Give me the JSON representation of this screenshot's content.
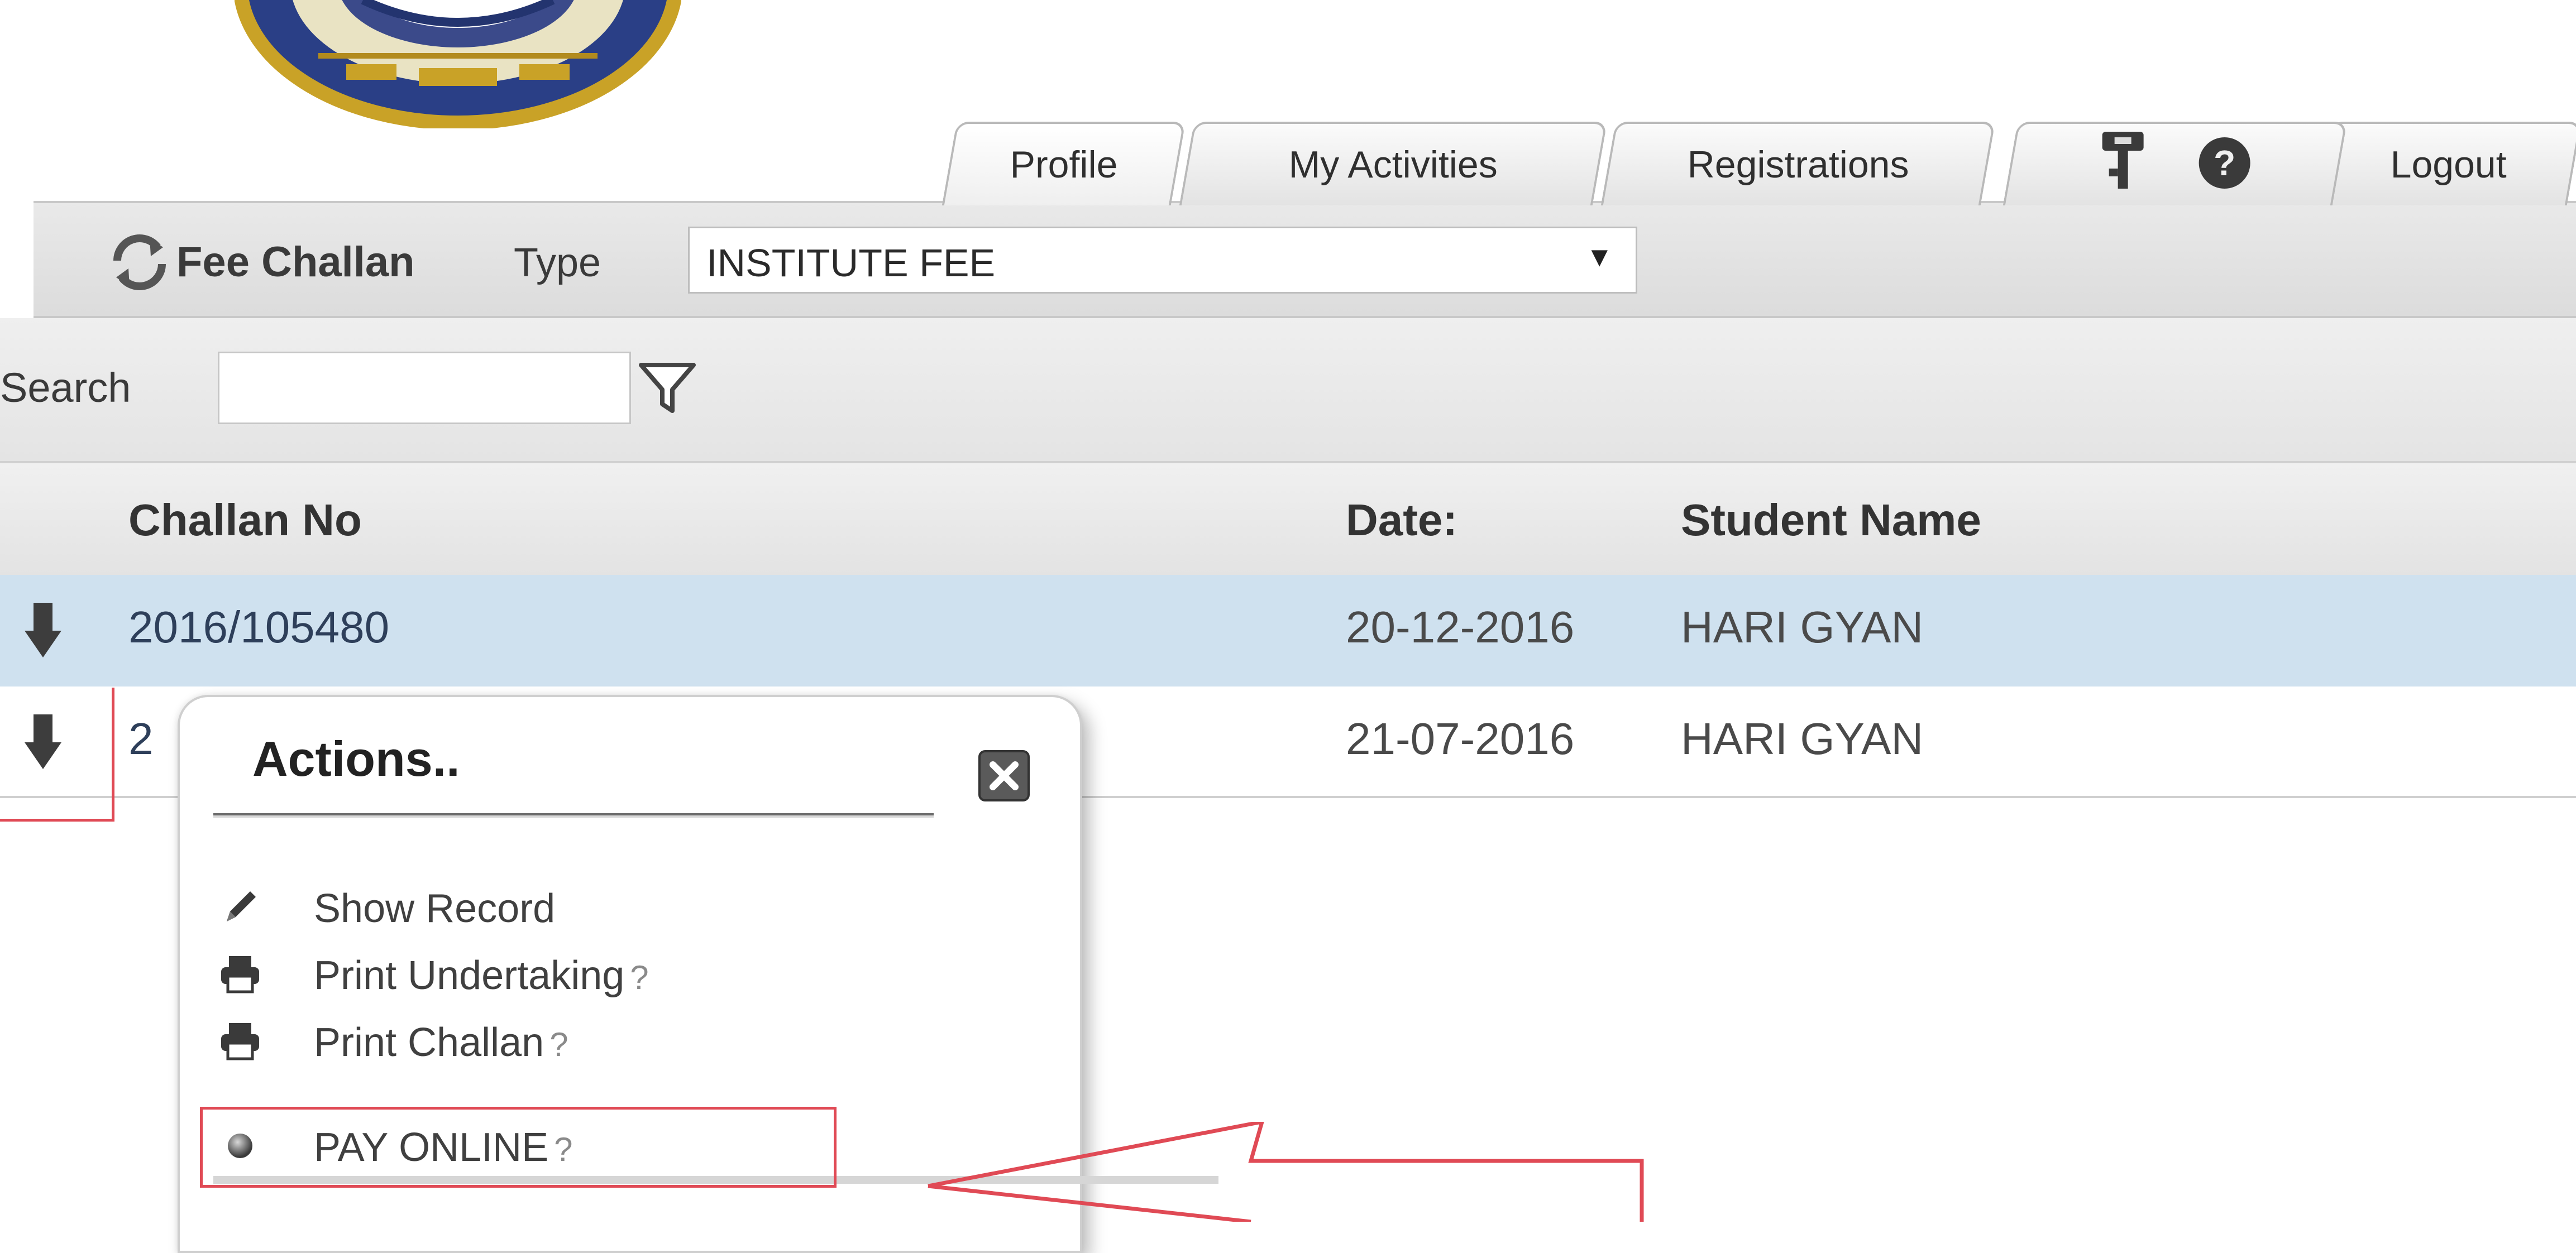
{
  "tabs": [
    {
      "label": "Profile"
    },
    {
      "label": "My Activities"
    },
    {
      "label": "Registrations"
    },
    {
      "icon": "key-icon"
    },
    {
      "icon": "help-icon"
    },
    {
      "label": "Logout"
    }
  ],
  "fee_bar": {
    "icon": "refresh-icon",
    "title": "Fee Challan",
    "type_label": "Type",
    "type_value": "INSTITUTE FEE"
  },
  "search": {
    "label": "Search",
    "value": "",
    "filter_icon": "filter-icon"
  },
  "grid": {
    "columns": [
      "Challan No",
      "Date:",
      "Student Name"
    ],
    "rows": [
      {
        "challan_no": "2016/105480",
        "date": "20-12-2016",
        "student_name": "HARI GYAN"
      },
      {
        "challan_no": "2",
        "date": "21-07-2016",
        "student_name": "HARI GYAN"
      }
    ]
  },
  "popup": {
    "title": "Actions..",
    "items": [
      {
        "label": "Show Record",
        "help": "",
        "icon": "pencil-icon"
      },
      {
        "label": "Print Undertaking",
        "help": "?",
        "icon": "printer-icon"
      },
      {
        "label": "Print Challan",
        "help": "?",
        "icon": "printer-icon"
      },
      {
        "label": "PAY ONLINE",
        "help": "?",
        "icon": "bullet-icon"
      }
    ]
  },
  "colors": {
    "selected_row": "#cfe1ef",
    "annotation_red": "#e04a55",
    "link_text": "#2e3f5a"
  }
}
